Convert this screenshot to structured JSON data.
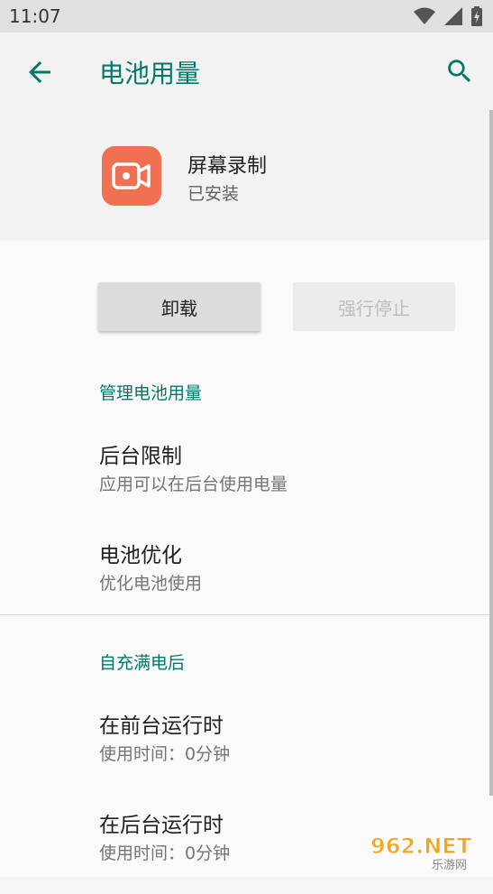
{
  "status_bar": {
    "time": "11:07"
  },
  "app_bar": {
    "title": "电池用量"
  },
  "app": {
    "name": "屏幕录制",
    "status": "已安装"
  },
  "buttons": {
    "uninstall": "卸载",
    "force_stop": "强行停止"
  },
  "section_manage": {
    "label": "管理电池用量",
    "items": [
      {
        "title": "后台限制",
        "subtitle": "应用可以在后台使用电量"
      },
      {
        "title": "电池优化",
        "subtitle": "优化电池使用"
      }
    ]
  },
  "section_since_full": {
    "label": "自充满电后",
    "items": [
      {
        "title": "在前台运行时",
        "subtitle": "使用时间：0分钟"
      },
      {
        "title": "在后台运行时",
        "subtitle": "使用时间：0分钟"
      }
    ]
  },
  "watermark": {
    "text": "962.NET",
    "sub": "乐游网"
  },
  "colors": {
    "accent": "#00796b",
    "app_icon_bg": "#f07152"
  }
}
